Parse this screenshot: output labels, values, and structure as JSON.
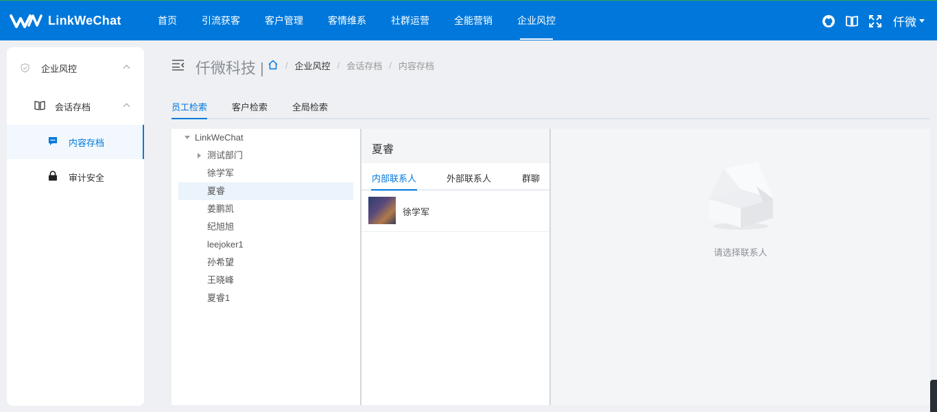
{
  "app": {
    "logo_text": "LinkWeChat",
    "nav": [
      "首页",
      "引流获客",
      "客户管理",
      "客情维系",
      "社群运营",
      "全能营销",
      "企业风控"
    ],
    "active_nav_index": 6,
    "user": "仟微",
    "icons": [
      "github-icon",
      "book-icon",
      "fullscreen-icon"
    ]
  },
  "sidebar": {
    "items": [
      {
        "label": "企业风控",
        "icon": "shield-icon"
      },
      {
        "label": "会话存档",
        "icon": "book-icon"
      },
      {
        "label": "内容存档",
        "icon": "chat-icon"
      },
      {
        "label": "审计安全",
        "icon": "lock-icon"
      }
    ],
    "active_index": 2
  },
  "header": {
    "company": "仟微科技 |",
    "breadcrumb": [
      "企业风控",
      "会话存档",
      "内容存档"
    ]
  },
  "tabs": {
    "items": [
      "员工检索",
      "客户检索",
      "全局检索"
    ],
    "active_index": 0
  },
  "tree": {
    "root": "LinkWeChat",
    "items": [
      "测试部门",
      "徐学军",
      "夏睿",
      "姜鹏凯",
      "纪旭旭",
      "leejoker1",
      "孙希望",
      "王晓峰",
      "夏睿1"
    ],
    "selected": "夏睿"
  },
  "contacts": {
    "title": "夏睿",
    "tabs": [
      "内部联系人",
      "外部联系人",
      "群聊"
    ],
    "active_tab_index": 0,
    "list": [
      {
        "name": "徐学军"
      }
    ]
  },
  "chat": {
    "empty_text": "请选择联系人"
  },
  "colors": {
    "primary": "#0078db",
    "bg": "#eef0f3"
  }
}
